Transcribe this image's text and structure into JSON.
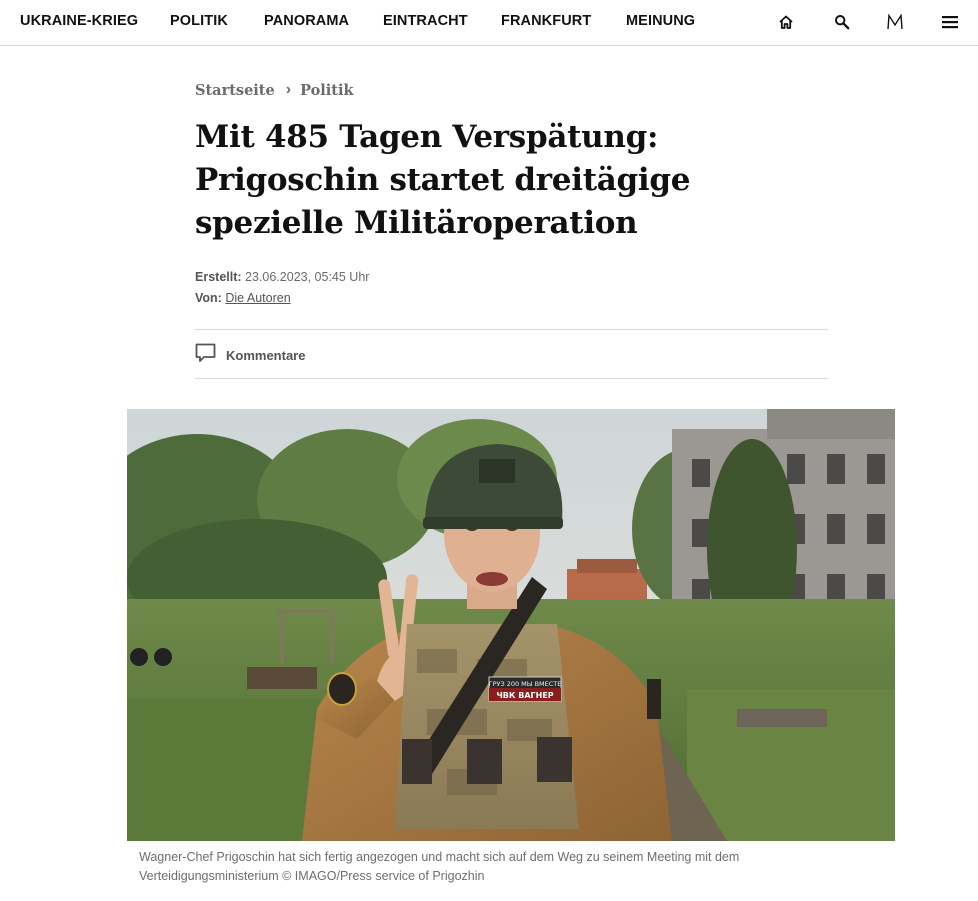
{
  "nav": {
    "items": [
      {
        "label": "UKRAINE-KRIEG"
      },
      {
        "label": "POLITIK"
      },
      {
        "label": "PANORAMA"
      },
      {
        "label": "EINTRACHT"
      },
      {
        "label": "FRANKFURT"
      },
      {
        "label": "MEINUNG"
      }
    ],
    "icons": [
      "home-icon",
      "search-icon",
      "m-logo-icon",
      "menu-icon"
    ],
    "logo_letter": "M"
  },
  "breadcrumb": {
    "home": "Startseite",
    "separator": "›",
    "section": "Politik"
  },
  "article": {
    "title": "Mit 485 Tagen Verspätung: Prigoschin startet dreitägige spezielle Militäroperation",
    "created_label": "Erstellt:",
    "created_value": "23.06.2023, 05:45 Uhr",
    "by_label": "Von:",
    "by_value": "Die Autoren",
    "comments_label": "Kommentare"
  },
  "image": {
    "caption": "Wagner-Chef Prigoschin hat sich fertig angezogen und macht sich auf dem Weg zu seinem Meeting mit dem Verteidigungsministerium © IMAGO/Press service of Prigozhin",
    "patch_top": "ГРУЗ 200 МЫ ВМЕСТЕ",
    "patch_bottom": "ЧВК ВАГНЕР"
  },
  "colors": {
    "text": "#111111",
    "muted": "#6b6b6b",
    "rule": "#d9d9d9"
  }
}
